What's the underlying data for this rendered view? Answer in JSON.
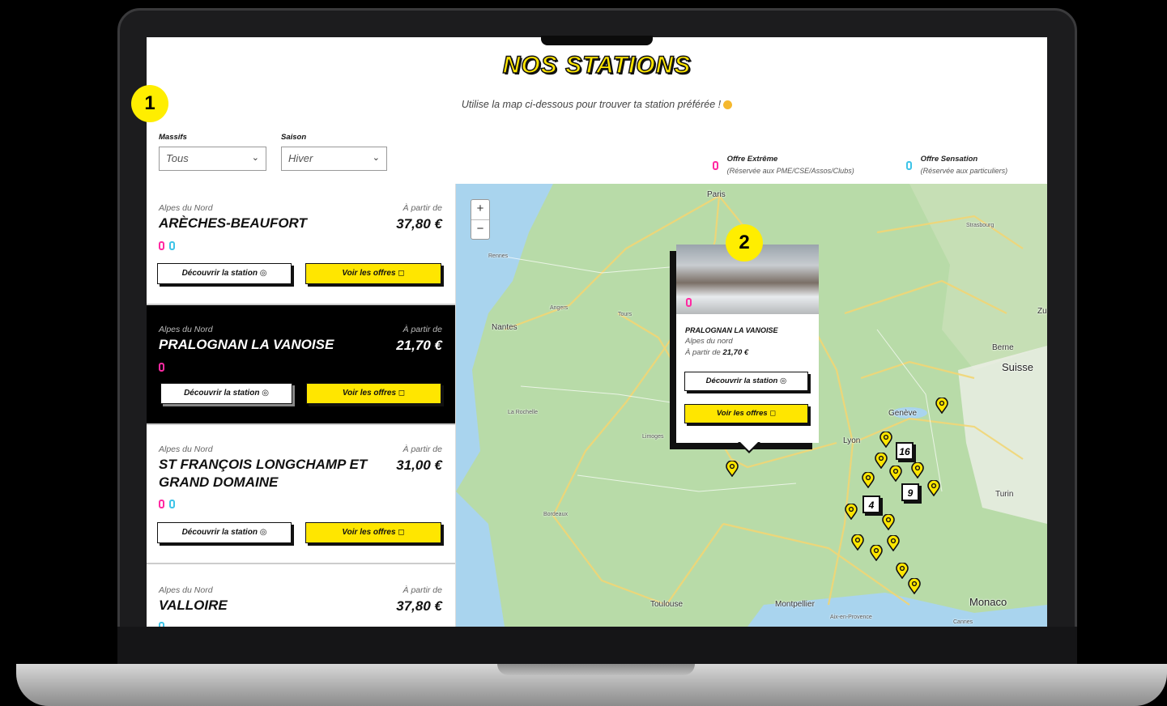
{
  "page": {
    "title": "NOS STATIONS",
    "subtitle": "Utilise la map ci-dessous pour trouver ta station préférée !"
  },
  "filters": {
    "massifs_label": "Massifs",
    "massifs_value": "Tous",
    "saison_label": "Saison",
    "saison_value": "Hiver"
  },
  "legend": [
    {
      "title": "Offre Extrême",
      "note": "(Réservée aux PME/CSE/Assos/Clubs)",
      "color": "#ff2aa2"
    },
    {
      "title": "Offre Sensation",
      "note": "(Réservée aux particuliers)",
      "color": "#3ec4e8"
    }
  ],
  "stations": [
    {
      "region": "Alpes du Nord",
      "from": "À partir de",
      "name": "ARÈCHES-BEAUFORT",
      "price": "37,80 €",
      "offers": [
        "extreme",
        "sensation"
      ],
      "discover": "Découvrir la station",
      "offers_btn": "Voir les offres"
    },
    {
      "region": "Alpes du Nord",
      "from": "À partir de",
      "name": "PRALOGNAN LA VANOISE",
      "price": "21,70 €",
      "offers": [
        "extreme"
      ],
      "discover": "Découvrir la station",
      "offers_btn": "Voir les offres"
    },
    {
      "region": "Alpes du Nord",
      "from": "À partir de",
      "name": "ST FRANÇOIS LONGCHAMP ET GRAND DOMAINE",
      "price": "31,00 €",
      "offers": [
        "extreme",
        "sensation"
      ],
      "discover": "Découvrir la station",
      "offers_btn": "Voir les offres"
    },
    {
      "region": "Alpes du Nord",
      "from": "À partir de",
      "name": "VALLOIRE",
      "price": "37,80 €",
      "offers": [
        "sensation"
      ]
    }
  ],
  "map": {
    "zoom_in": "+",
    "zoom_out": "−",
    "cities": [
      "Paris",
      "Rennes",
      "Nantes",
      "Angers",
      "Tours",
      "La Rochelle",
      "Limoges",
      "Bordeaux",
      "Toulouse",
      "Montpellier",
      "Lyon",
      "Genève",
      "Berne",
      "Suisse",
      "Turin",
      "Monaco",
      "Strasbourg",
      "Aix-en-Provence",
      "Cannes",
      "Zu"
    ],
    "clusters": [
      "16",
      "9",
      "4"
    ],
    "popup": {
      "name": "PRALOGNAN LA VANOISE",
      "region": "Alpes du nord",
      "price_prefix": "À partir de",
      "price": "21,70 €",
      "discover": "Découvrir la station",
      "offers_btn": "Voir les offres"
    }
  },
  "annotations": [
    "1",
    "2"
  ]
}
